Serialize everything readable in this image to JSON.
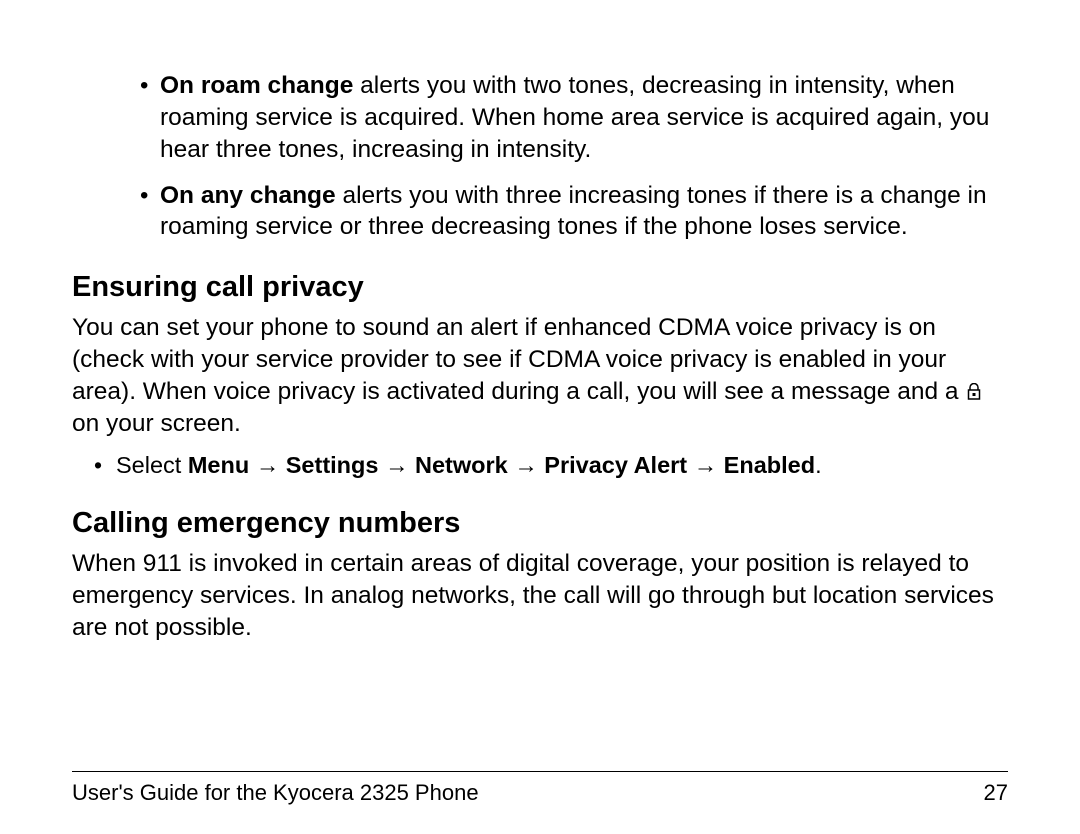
{
  "bullets": {
    "roam_change": {
      "label": "On roam change",
      "text": " alerts you with two tones, decreasing in intensity, when roaming service is acquired. When home area service is acquired again, you hear three tones, increasing in intensity."
    },
    "any_change": {
      "label": "On any change",
      "text": " alerts you with three increasing tones if there is a change in roaming service or three decreasing tones if the phone loses service."
    }
  },
  "section1": {
    "heading": "Ensuring call privacy",
    "body_pre": "You can set your phone to sound an alert if enhanced CDMA voice privacy is on (check with your service provider to see if CDMA voice privacy is enabled in your area). When voice privacy is activated during a call, you will see a message and a ",
    "body_post": " on your screen.",
    "menu_prefix": "Select ",
    "menu_path": "Menu → Settings → Network → Privacy Alert → Enabled",
    "menu_suffix": "."
  },
  "section2": {
    "heading": "Calling emergency numbers",
    "body": "When 911 is invoked in certain areas of digital coverage, your position is relayed to emergency services. In analog networks, the call will go through but location services are not possible."
  },
  "footer": {
    "title": "User's Guide for the Kyocera 2325 Phone",
    "page": "27"
  }
}
